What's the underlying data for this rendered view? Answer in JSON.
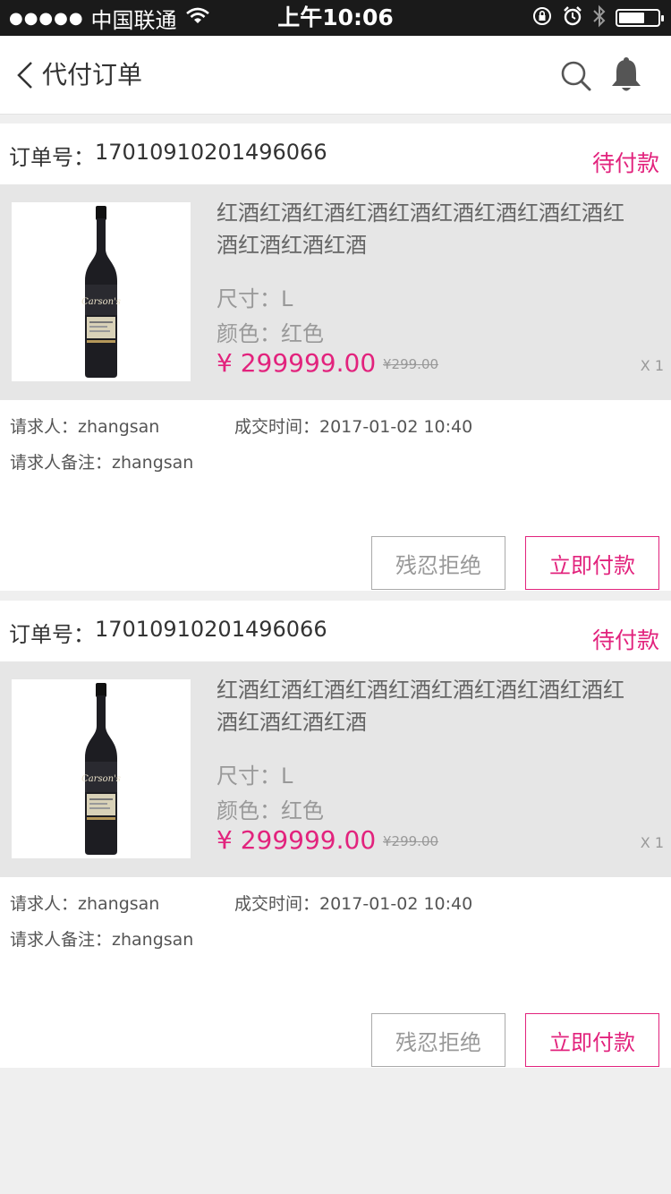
{
  "status_bar": {
    "signal": "●●●●●",
    "carrier": "中国联通",
    "time": "上午10:06"
  },
  "nav": {
    "title": "代付订单"
  },
  "orders": [
    {
      "order_no_label": "订单号：",
      "order_no": "17010910201496066",
      "status": "待付款",
      "product": {
        "name": "红酒红酒红酒红酒红酒红酒红酒红酒红酒红酒红酒红酒红酒",
        "size": "尺寸：L",
        "color": "颜色：红色",
        "price": "¥ 299999.00",
        "old_price": "¥299.00",
        "quantity": "X 1",
        "bottle_label": "Carson's"
      },
      "requester": "请求人：zhangsan",
      "deal_time": "成交时间：2017-01-02  10:40",
      "note": "请求人备注：zhangsan",
      "reject_label": "残忍拒绝",
      "pay_label": "立即付款"
    },
    {
      "order_no_label": "订单号：",
      "order_no": "17010910201496066",
      "status": "待付款",
      "product": {
        "name": "红酒红酒红酒红酒红酒红酒红酒红酒红酒红酒红酒红酒红酒",
        "size": "尺寸：L",
        "color": "颜色：红色",
        "price": "¥ 299999.00",
        "old_price": "¥299.00",
        "quantity": "X 1",
        "bottle_label": "Carson's"
      },
      "requester": "请求人：zhangsan",
      "deal_time": "成交时间：2017-01-02  10:40",
      "note": "请求人备注：zhangsan",
      "reject_label": "残忍拒绝",
      "pay_label": "立即付款"
    }
  ],
  "colors": {
    "accent": "#e2237d",
    "status_bar_bg": "#1a1a1a",
    "product_bg": "#e6e6e6",
    "page_bg": "#efefef"
  },
  "icons": [
    "signal-dots-icon",
    "wifi-icon",
    "rotation-lock-icon",
    "alarm-icon",
    "bluetooth-icon",
    "battery-icon",
    "back-chevron-icon",
    "search-icon",
    "bell-icon",
    "wine-bottle-image"
  ],
  "battery_level": 0.6
}
